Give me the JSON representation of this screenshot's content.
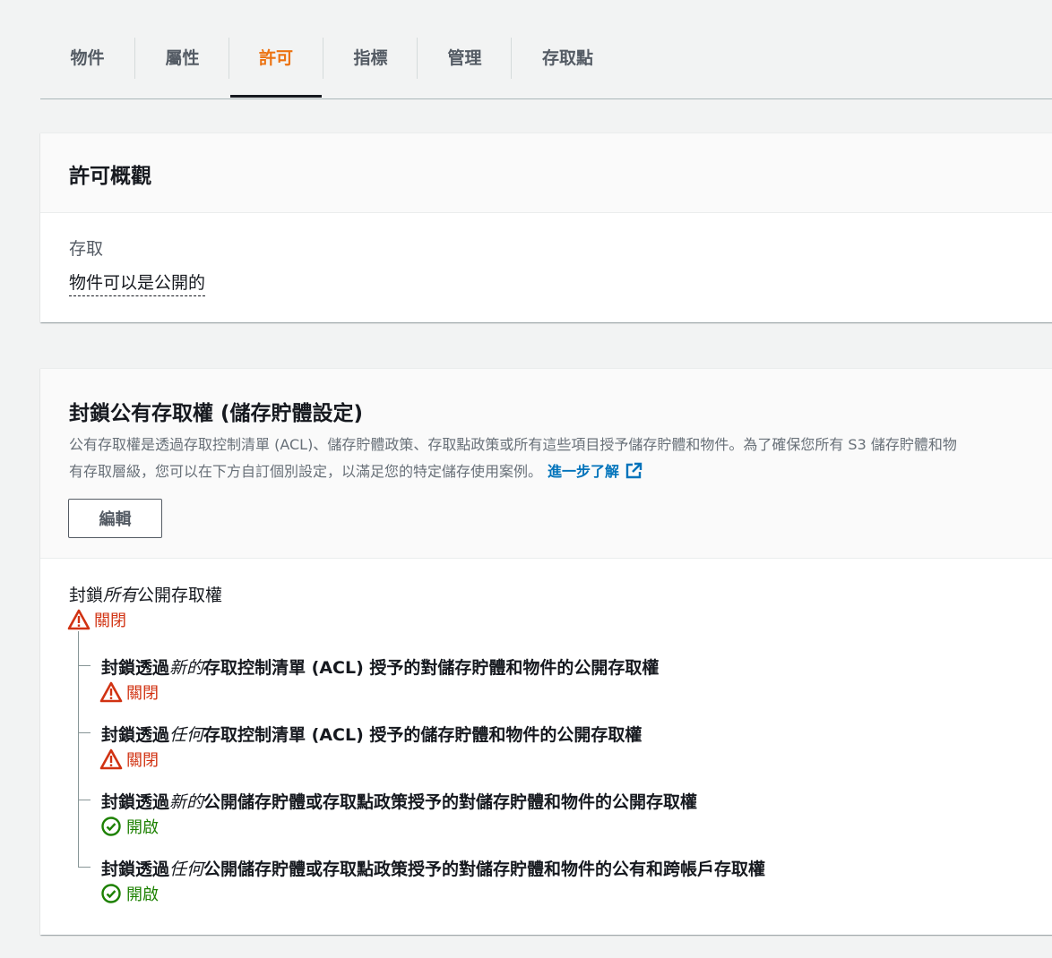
{
  "tabs": [
    {
      "label": "物件",
      "active": false
    },
    {
      "label": "屬性",
      "active": false
    },
    {
      "label": "許可",
      "active": true
    },
    {
      "label": "指標",
      "active": false
    },
    {
      "label": "管理",
      "active": false
    },
    {
      "label": "存取點",
      "active": false
    }
  ],
  "colors": {
    "accent": "#ec7211",
    "link": "#0073bb",
    "off": "#d13212",
    "on": "#1d8102"
  },
  "overview": {
    "title": "許可概觀",
    "access_label": "存取",
    "access_value": "物件可以是公開的"
  },
  "block_public": {
    "title": "封鎖公有存取權 (儲存貯體設定)",
    "description_line1": "公有存取權是透過存取控制清單 (ACL)、儲存貯體政策、存取點政策或所有這些項目授予儲存貯體和物件。為了確保您所有 S3 儲存貯體和物",
    "description_line2": "有存取層級，您可以在下方自訂個別設定，以滿足您的特定儲存使用案例。",
    "learn_more": "進一步了解",
    "edit_button": "編輯",
    "main_setting": {
      "prefix": "封鎖",
      "emphasis": "所有",
      "suffix": "公開存取權",
      "status": "關閉",
      "status_icon": "warning-icon"
    },
    "sub_settings": [
      {
        "prefix": "封鎖透過",
        "emphasis": "新的",
        "suffix": "存取控制清單 (ACL) 授予的對儲存貯體和物件的公開存取權",
        "status": "關閉",
        "status_icon": "warning-icon"
      },
      {
        "prefix": "封鎖透過",
        "emphasis": "任何",
        "suffix": "存取控制清單 (ACL) 授予的儲存貯體和物件的公開存取權",
        "status": "關閉",
        "status_icon": "warning-icon"
      },
      {
        "prefix": "封鎖透過",
        "emphasis": "新的",
        "suffix": "公開儲存貯體或存取點政策授予的對儲存貯體和物件的公開存取權",
        "status": "開啟",
        "status_icon": "check-circle-icon"
      },
      {
        "prefix": "封鎖透過",
        "emphasis": "任何",
        "suffix": "公開儲存貯體或存取點政策授予的對儲存貯體和物件的公有和跨帳戶存取權",
        "status": "開啟",
        "status_icon": "check-circle-icon"
      }
    ]
  }
}
